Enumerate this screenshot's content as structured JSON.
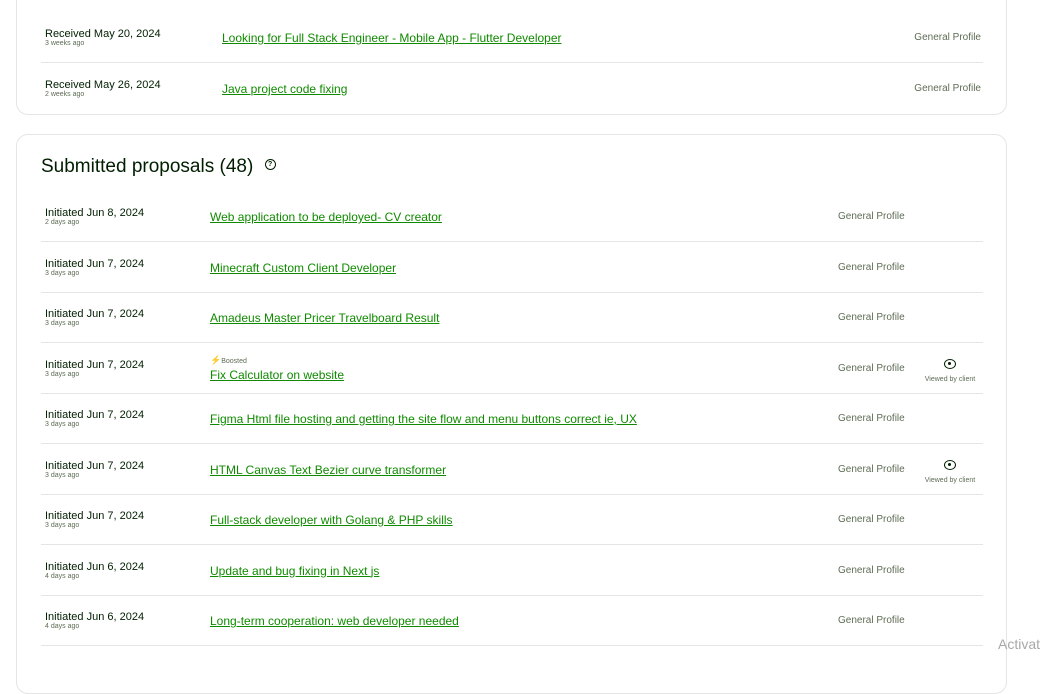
{
  "received": [
    {
      "date": "Received May 20, 2024",
      "ago": "3 weeks ago",
      "title": "Looking for Full Stack Engineer - Mobile App - Flutter Developer",
      "profile": "General Profile"
    },
    {
      "date": "Received May 26, 2024",
      "ago": "2 weeks ago",
      "title": "Java project code fixing",
      "profile": "General Profile"
    }
  ],
  "submitted": {
    "heading": "Submitted proposals",
    "count": "(48)",
    "help_icon": "help-circle-icon",
    "boosted_label": "Boosted",
    "viewed_label": "Viewed by client",
    "rows": [
      {
        "date": "Initiated Jun 8, 2024",
        "ago": "2 days ago",
        "title": "Web application to be deployed- CV creator",
        "profile": "General Profile",
        "boosted": false,
        "viewed": false
      },
      {
        "date": "Initiated Jun 7, 2024",
        "ago": "3 days ago",
        "title": "Minecraft Custom Client Developer",
        "profile": "General Profile",
        "boosted": false,
        "viewed": false
      },
      {
        "date": "Initiated Jun 7, 2024",
        "ago": "3 days ago",
        "title": "Amadeus Master Pricer Travelboard Result",
        "profile": "General Profile",
        "boosted": false,
        "viewed": false
      },
      {
        "date": "Initiated Jun 7, 2024",
        "ago": "3 days ago",
        "title": "Fix Calculator on website",
        "profile": "General Profile",
        "boosted": true,
        "viewed": true
      },
      {
        "date": "Initiated Jun 7, 2024",
        "ago": "3 days ago",
        "title": "Figma Html file hosting and getting the site flow and menu buttons correct ie, UX",
        "profile": "General Profile",
        "boosted": false,
        "viewed": false
      },
      {
        "date": "Initiated Jun 7, 2024",
        "ago": "3 days ago",
        "title": "HTML Canvas Text Bezier curve transformer",
        "profile": "General Profile",
        "boosted": false,
        "viewed": true
      },
      {
        "date": "Initiated Jun 7, 2024",
        "ago": "3 days ago",
        "title": "Full-stack developer with Golang & PHP skills",
        "profile": "General Profile",
        "boosted": false,
        "viewed": false
      },
      {
        "date": "Initiated Jun 6, 2024",
        "ago": "4 days ago",
        "title": "Update and bug fixing in Next js",
        "profile": "General Profile",
        "boosted": false,
        "viewed": false
      },
      {
        "date": "Initiated Jun 6, 2024",
        "ago": "4 days ago",
        "title": "Long-term cooperation: web developer needed",
        "profile": "General Profile",
        "boosted": false,
        "viewed": false
      }
    ]
  },
  "watermark": "Activat",
  "colors": {
    "link": "#108a00",
    "text": "#001e00",
    "muted": "#5e6d55",
    "border": "#e4e5e4",
    "boost": "#1f57c3"
  }
}
